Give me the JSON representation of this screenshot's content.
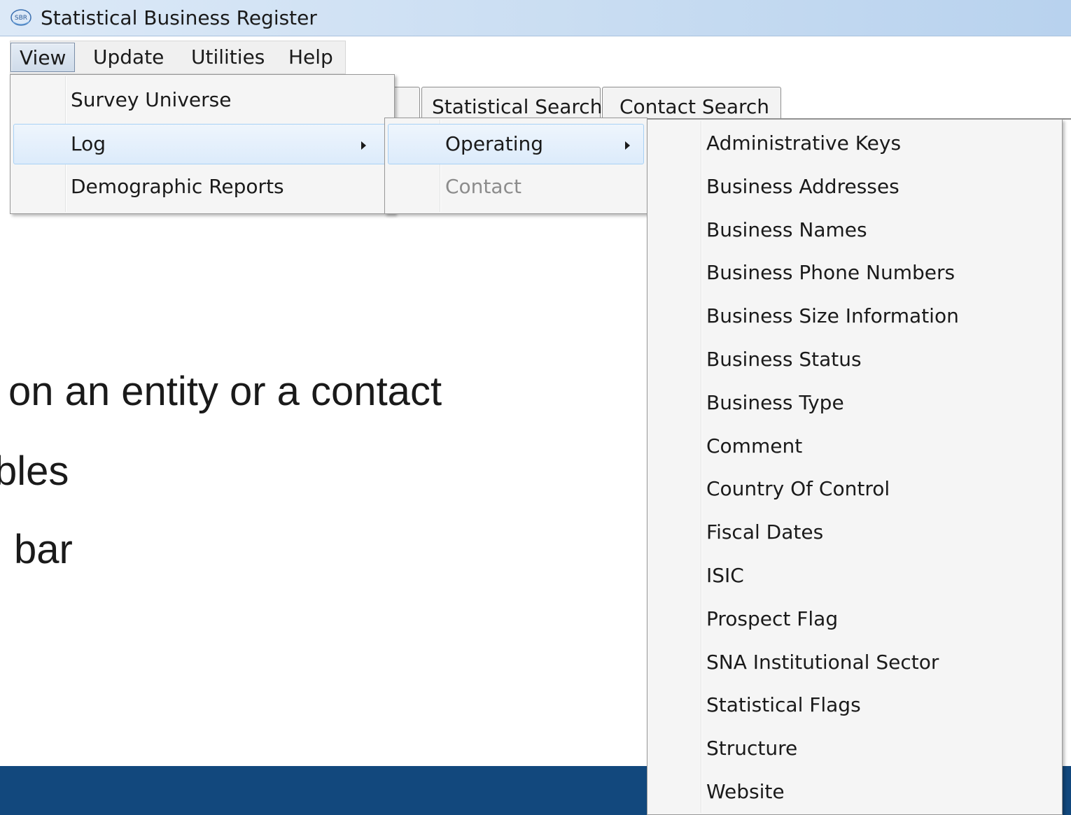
{
  "window": {
    "title": "Statistical Business Register",
    "icon": "sbr-logo-icon"
  },
  "menubar": {
    "items": [
      {
        "label": "View",
        "active": true
      },
      {
        "label": "Update"
      },
      {
        "label": "Utilities"
      },
      {
        "label": "Help"
      }
    ]
  },
  "tabs": [
    {
      "label": ""
    },
    {
      "label": "Statistical Search"
    },
    {
      "label": "Contact Search"
    }
  ],
  "view_menu": {
    "items": [
      {
        "label": "Survey Universe",
        "has_submenu": false
      },
      {
        "label": "Log",
        "has_submenu": true,
        "highlighted": true
      },
      {
        "label": "Demographic Reports",
        "has_submenu": false
      }
    ]
  },
  "log_menu": {
    "items": [
      {
        "label": "Operating",
        "has_submenu": true,
        "highlighted": true
      },
      {
        "label": "Contact",
        "disabled": true
      }
    ]
  },
  "operating_menu": {
    "items": [
      "Administrative Keys",
      "Business Addresses",
      "Business Names",
      "Business Phone Numbers",
      "Business Size Information",
      "Business Status",
      "Business Type",
      "Comment",
      "Country Of Control",
      "Fiscal Dates",
      "ISIC",
      "Prospect Flag",
      "SNA Institutional Sector",
      "Statistical Flags",
      "Structure",
      "Website"
    ]
  },
  "background_text": {
    "line1": "on an entity or a contact",
    "line2": "bles",
    "line3": "bar"
  },
  "colors": {
    "titlebar": "#c9ddf2",
    "menu_highlight": "#dcebfb",
    "bottom_band": "#12487d"
  }
}
